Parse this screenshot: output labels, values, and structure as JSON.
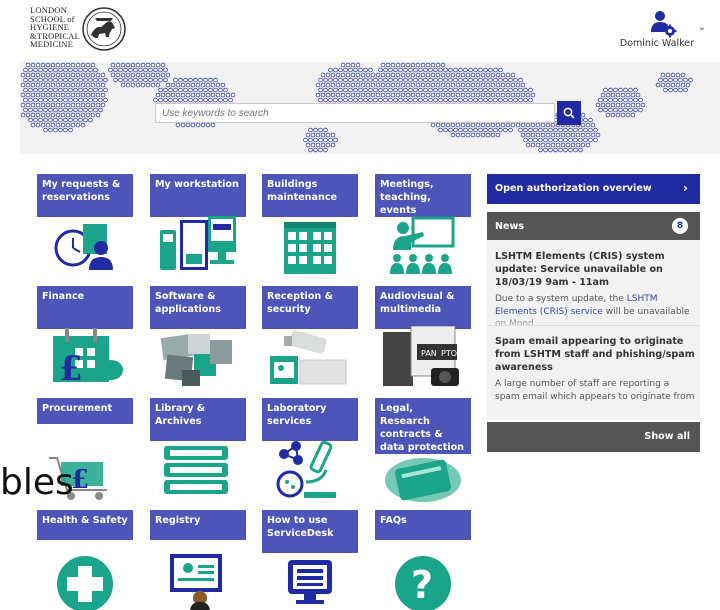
{
  "header": {
    "logo_text": [
      "LONDON",
      "SCHOOL of",
      "HYGIENE",
      "&TROPICAL",
      "MEDICINE"
    ],
    "user_name": "Dominic Walker",
    "user_icon": "user-settings-icon",
    "chevron_icon": "chevron-down-icon"
  },
  "search": {
    "placeholder": "Use keywords to search",
    "button_icon": "search-icon"
  },
  "tiles": [
    {
      "label": "My requests & reservations",
      "icon": "clock-user-icon"
    },
    {
      "label": "My workstation",
      "icon": "workstation-icon"
    },
    {
      "label": "Buildings maintenance",
      "icon": "building-icon"
    },
    {
      "label": "Meetings, teaching, events",
      "icon": "presentation-icon"
    },
    {
      "label": "Finance",
      "icon": "finance-calendar-icon"
    },
    {
      "label": "Software & applications",
      "icon": "software-icon"
    },
    {
      "label": "Reception & security",
      "icon": "security-camera-icon"
    },
    {
      "label": "Audiovisual & multimedia",
      "icon": "audiovisual-icon"
    },
    {
      "label": "Procurement",
      "icon": "shopping-cart-icon"
    },
    {
      "label": "Library & Archives",
      "icon": "books-icon"
    },
    {
      "label": "Laboratory services",
      "icon": "microscope-icon"
    },
    {
      "label": "Legal, Research contracts & data protection",
      "icon": "data-card-icon"
    },
    {
      "label": "Health & Safety",
      "icon": "medical-cross-icon"
    },
    {
      "label": "Registry",
      "icon": "registry-icon"
    },
    {
      "label": "How to use ServiceDesk",
      "icon": "monitor-icon"
    },
    {
      "label": "FAQs",
      "icon": "question-icon"
    }
  ],
  "side": {
    "auth_label": "Open authorization overview",
    "news_label": "News",
    "news_count": "8",
    "news": [
      {
        "title": "LSHTM Elements (CRIS) system update: Service unavailable on 18/03/19 9am - 11am",
        "text_before": "Due to a system update, the ",
        "text_link": "LSHTM Elements (CRIS) service",
        "text_after": " will be unavailable on Mond"
      },
      {
        "title": "Spam email appearing to originate from LSHTM staff and phishing/spam awareness",
        "text_before": "A large number of staff are reporting a spam email which appears to originate from",
        "text_link": "",
        "text_after": ""
      }
    ],
    "show_all": "Show all"
  },
  "overlay_text": "bles",
  "colors": {
    "tile": "#4d55b8",
    "primary": "#1f2aa3",
    "teal": "#1aa58a",
    "panel_dark": "#555555",
    "panel_light": "#f2f2f2"
  }
}
